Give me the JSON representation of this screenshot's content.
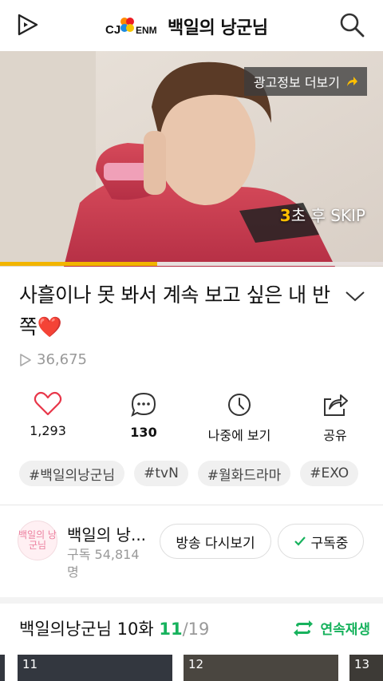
{
  "header": {
    "brand_name": "백일의 낭군님",
    "logo_text": "CJ ENM"
  },
  "video": {
    "ad_more_label": "광고정보 더보기",
    "skip_count": "3",
    "skip_text": "초 후 SKIP",
    "progress": 0.41
  },
  "info": {
    "title": "사흘이나 못 봐서 계속 보고 싶은 내 반쪽",
    "title_emoji": "❤️",
    "views": "36,675"
  },
  "actions": [
    {
      "label": "1,293",
      "icon": "heart-icon"
    },
    {
      "label": "130",
      "icon": "comment-icon"
    },
    {
      "label": "나중에 보기",
      "icon": "clock-icon"
    },
    {
      "label": "공유",
      "icon": "share-icon"
    }
  ],
  "tags": [
    "#백일의낭군님",
    "#tvN",
    "#월화드라마",
    "#EXO"
  ],
  "channel": {
    "name": "백일의 낭...",
    "subscribers": "구독 54,814 명",
    "avatar_text": "백일의 낭군님",
    "replay_button": "방송 다시보기",
    "subscribe_button": "구독중"
  },
  "playlist": {
    "title": "백일의낭군님 10화",
    "current": "11",
    "total": "/19",
    "continuous_label": "연속재생",
    "thumbs": [
      "11",
      "12",
      "13"
    ]
  },
  "colors": {
    "accent_green": "#17b25d",
    "progress": "#f2b500",
    "skip_count": "#ffbf00"
  }
}
